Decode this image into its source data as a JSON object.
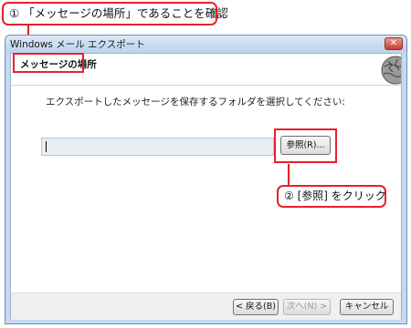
{
  "callouts": {
    "step1": "① 「メッセージの場所」であることを確認",
    "step2": "② [参照] をクリック"
  },
  "window": {
    "title": "Windows メール エクスポート",
    "close_label": "✕"
  },
  "header": {
    "title": "メッセージの場所"
  },
  "main": {
    "instruction": "エクスポートしたメッセージを保存するフォルダを選択してください:",
    "path_value": "",
    "browse_label": "参照(R)..."
  },
  "footer": {
    "back_label": "< 戻る(B)",
    "next_label": "次へ(N) >",
    "cancel_label": "キャンセル"
  },
  "colors": {
    "accent_red": "#e8202a",
    "titlebar": "#c6d9ee"
  }
}
